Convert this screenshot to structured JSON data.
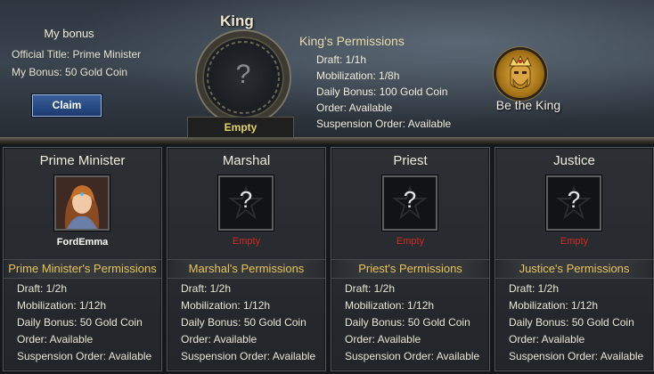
{
  "my_bonus": {
    "title": "My bonus",
    "official_title": "Official Title: Prime Minister",
    "bonus": "My Bonus: 50 Gold Coin",
    "claim_label": "Claim"
  },
  "king": {
    "label": "King",
    "status": "Empty",
    "portrait_placeholder": "?",
    "permissions_title": "King's Permissions",
    "permissions": [
      "Draft: 1/1h",
      "Mobilization: 1/8h",
      "Daily Bonus: 100 Gold Coin",
      "Order: Available",
      "Suspension Order: Available"
    ],
    "be_king_label": "Be the King",
    "be_king_icon": "crowned-king-face-icon"
  },
  "positions": [
    {
      "title": "Prime Minister",
      "holder": "FordEmma",
      "occupied": true,
      "portrait_placeholder": "",
      "permissions_title": "Prime Minister's Permissions",
      "permissions": [
        "Draft: 1/2h",
        "Mobilization: 1/12h",
        "Daily Bonus: 50 Gold Coin",
        "Order: Available",
        "Suspension Order: Available"
      ]
    },
    {
      "title": "Marshal",
      "holder": "Empty",
      "occupied": false,
      "portrait_placeholder": "?",
      "permissions_title": "Marshal's Permissions",
      "permissions": [
        "Draft: 1/2h",
        "Mobilization: 1/12h",
        "Daily Bonus: 50 Gold Coin",
        "Order: Available",
        "Suspension Order: Available"
      ]
    },
    {
      "title": "Priest",
      "holder": "Empty",
      "occupied": false,
      "portrait_placeholder": "?",
      "permissions_title": "Priest's Permissions",
      "permissions": [
        "Draft: 1/2h",
        "Mobilization: 1/12h",
        "Daily Bonus: 50 Gold Coin",
        "Order: Available",
        "Suspension Order: Available"
      ]
    },
    {
      "title": "Justice",
      "holder": "Empty",
      "occupied": false,
      "portrait_placeholder": "?",
      "permissions_title": "Justice's Permissions",
      "permissions": [
        "Draft: 1/2h",
        "Mobilization: 1/12h",
        "Daily Bonus: 50 Gold Coin",
        "Order: Available",
        "Suspension Order: Available"
      ]
    }
  ],
  "colors": {
    "empty_status": "#d02a20",
    "king_empty": "#e6d36a",
    "permissions_title": "#e9c25a",
    "claim_button": "#1b3a70"
  }
}
